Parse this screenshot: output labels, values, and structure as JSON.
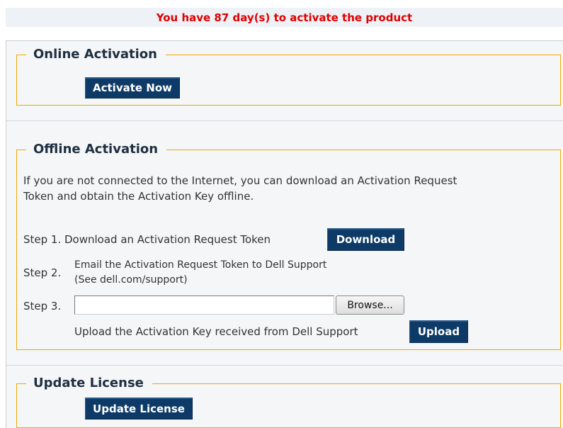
{
  "banner": {
    "text": "You have 87 day(s) to activate the product"
  },
  "online": {
    "legend": "Online Activation",
    "activate_label": "Activate Now"
  },
  "offline": {
    "legend": "Offline Activation",
    "intro_line1": "If you are not connected to the Internet, you can download an Activation Request",
    "intro_line2": "Token and obtain the Activation Key offline.",
    "step1_label": "Step 1. Download an Activation Request Token",
    "download_label": "Download",
    "step2_label": "Step 2.",
    "step2_line1": "Email the Activation Request Token to Dell Support",
    "step2_line2": "(See dell.com/support)",
    "step3_label": "Step 3.",
    "file_value": "",
    "browse_label": "Browse...",
    "upload_text": "Upload the Activation Key received from Dell Support",
    "upload_label": "Upload"
  },
  "update": {
    "legend": "Update License",
    "update_label": "Update License"
  },
  "colors": {
    "banner_text": "#e00000",
    "button_bg": "#0d3a66",
    "fieldset_border": "#f0a900"
  }
}
